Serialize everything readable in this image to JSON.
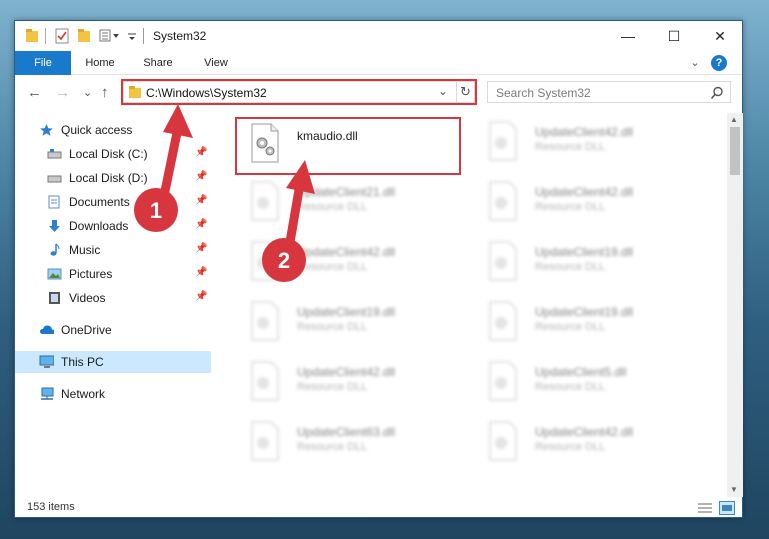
{
  "window": {
    "title": "System32",
    "minimize_glyph": "—",
    "maximize_glyph": "☐",
    "close_glyph": "✕"
  },
  "ribbon": {
    "tabs": [
      "File",
      "Home",
      "Share",
      "View"
    ],
    "expand_glyph": "⌄",
    "help_glyph": "?"
  },
  "address": {
    "path": "C:\\Windows\\System32",
    "back_glyph": "←",
    "forward_glyph": "→",
    "recent_glyph": "⌄",
    "up_glyph": "↑",
    "dropdown_glyph": "⌄",
    "refresh_glyph": "↻"
  },
  "search": {
    "placeholder": "Search System32"
  },
  "nav": {
    "items": [
      {
        "label": "Quick access",
        "icon": "star-icon"
      },
      {
        "label": "Local Disk (C:)",
        "icon": "drive-icon",
        "pinned": true
      },
      {
        "label": "Local Disk (D:)",
        "icon": "drive-icon",
        "pinned": true
      },
      {
        "label": "Documents",
        "icon": "documents-icon",
        "pinned": true
      },
      {
        "label": "Downloads",
        "icon": "downloads-icon",
        "pinned": true
      },
      {
        "label": "Music",
        "icon": "music-icon",
        "pinned": true
      },
      {
        "label": "Pictures",
        "icon": "pictures-icon",
        "pinned": true
      },
      {
        "label": "Videos",
        "icon": "videos-icon",
        "pinned": true
      },
      {
        "label": "OneDrive",
        "icon": "cloud-icon"
      },
      {
        "label": "This PC",
        "icon": "computer-icon",
        "selected": true
      },
      {
        "label": "Network",
        "icon": "network-icon"
      }
    ]
  },
  "files": {
    "highlighted": {
      "name": "kmaudio.dll",
      "type": ""
    },
    "left_column": [
      {
        "name": "UpdateClient21.dll",
        "type": "Resource DLL"
      },
      {
        "name": "UpdateClient42.dll",
        "type": "Resource DLL"
      },
      {
        "name": "UpdateClient19.dll",
        "type": "Resource DLL"
      },
      {
        "name": "UpdateClient42.dll",
        "type": "Resource DLL"
      },
      {
        "name": "UpdateClient63.dll",
        "type": "Resource DLL"
      }
    ],
    "right_column": [
      {
        "name": "UpdateClient42.dll",
        "type": "Resource DLL"
      },
      {
        "name": "UpdateClient42.dll",
        "type": "Resource DLL"
      },
      {
        "name": "UpdateClient19.dll",
        "type": "Resource DLL"
      },
      {
        "name": "UpdateClient19.dll",
        "type": "Resource DLL"
      },
      {
        "name": "UpdateClient5.dll",
        "type": "Resource DLL"
      },
      {
        "name": "UpdateClient42.dll",
        "type": "Resource DLL"
      }
    ]
  },
  "status": {
    "item_count": "153 items"
  },
  "callouts": [
    "1",
    "2"
  ],
  "colors": {
    "accent": "#1979ca",
    "highlight": "#d8363e",
    "selection": "#cce8ff"
  }
}
